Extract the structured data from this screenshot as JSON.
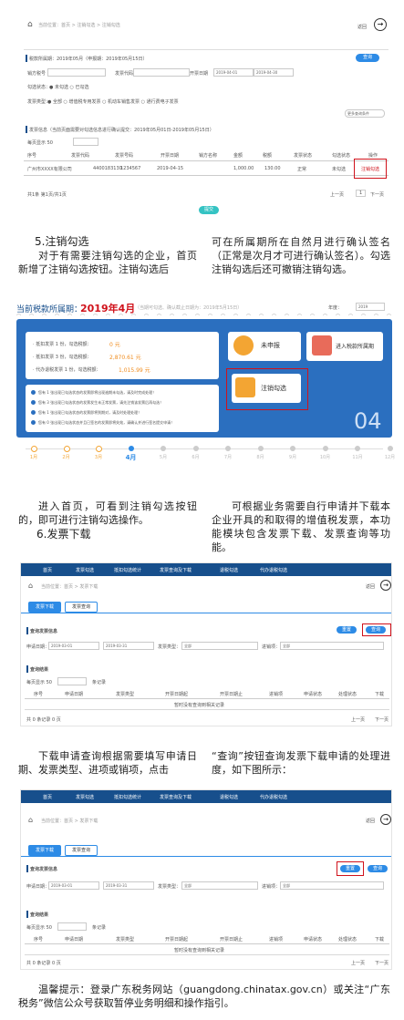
{
  "s1": {
    "home": "当前位置：首页 > 注销勾选 > 注销勾选",
    "return": "返回",
    "period_label": "税款所属期：2019年05月（申报期：2019年05月15日）",
    "query_btn": "查询",
    "f_buyer": "销方税号",
    "f_code": "发票代码",
    "f_date": "开票日期",
    "date_from": "2019-04-01",
    "date_to": "2019-04-30",
    "f_status": "勾选状态：",
    "status_opts": "● 未勾选  ○ 已勾选",
    "f_type": "发票类型：",
    "type_opts": "● 全部  ○ 增值税专用发票  ○ 机动车销售发票  ○ 通行费电子发票",
    "more_btn": "更多查询条件",
    "result_label": "发票信息（当前页面需要对勾选信息进行确认提交：2019年05月01日-2019年05月15日）",
    "per_page": "每页显示 50",
    "headers": [
      "序号",
      "发票代码",
      "发票号码",
      "开票日期",
      "销方名称",
      "金额",
      "税额",
      "发票状态",
      "勾选状态",
      "操作"
    ],
    "row": [
      "1",
      "广州市XXXX有限公司",
      "4400183130",
      "1234567",
      "2019-04-15",
      "1,000.00",
      "130.00",
      "正常",
      "未勾选",
      "注销勾选"
    ],
    "pager_info": "共1条  第1页/共1页",
    "prev": "上一页",
    "page_no": "1",
    "next": "下一页",
    "submit": "提交"
  },
  "p1": {
    "heading": "5.注销勾选",
    "left": "对于有需要注销勾选的企业，首页新增了注销勾选按钮。注销勾选后",
    "right": "可在所属期所在自然月进行确认签名（正常是次月才可进行确认签名）。勾选注销勾选后还可撤销注销勾选。"
  },
  "s2": {
    "title_pre": "当前税款所属期：",
    "title_period": "2019年4月",
    "title_note": "（当期可勾选、确认截止日期为：2019年5月15日）",
    "year_label": "年度：",
    "year_value": "2019",
    "stats": [
      {
        "label": "·  抵扣发票 1 份，勾选税额：",
        "value": "0 元"
      },
      {
        "label": "·  抵扣发票 3 份，勾选税额：",
        "value": "2,870.61 元"
      },
      {
        "label": "·  代办退税发票 1 份，勾选税额：",
        "value": "1,015.99 元"
      }
    ],
    "notices": [
      "您有 1 张出现已勾选状态的发票即将出现逾期未勾选，请及时完成处理！",
      "您有 3 张出现已勾选状态的发票发生未正常发票，请先注销该发票后再勾选！",
      "您有 1 张出现已勾选状态的发票即将到期对，请及时处理处理！",
      "您有 0 张出现已勾选状态并且已签名的发票即将失效，请确认并进行签名提交申请！"
    ],
    "card_weishen": "未申报",
    "card_jinru": "进入税款所属期",
    "card_zhuxiao": "注销勾选",
    "big_month": "04",
    "months": [
      "1月",
      "2月",
      "3月",
      "4月",
      "5月",
      "6月",
      "7月",
      "8月",
      "9月",
      "10月",
      "11月",
      "12月"
    ]
  },
  "p2": {
    "left": "进入首页，可看到注销勾选按钮的，即可进行注销勾选操作。",
    "heading": "6.发票下载",
    "right": "可根据业务需要自行申请并下载本企业开具的和取得的增值税发票，本功能模块包含发票下载、发票查询等功能。"
  },
  "s3": {
    "nav": [
      "首页",
      "发票勾选",
      "抵扣勾选统计",
      "发票查询及下载",
      "退税勾选",
      "代办退税勾选"
    ],
    "home": "当前位置：首页 > 发票下载",
    "return": "返回",
    "tab1": "发票下载",
    "tab2": "发票查询",
    "section": "查询发票信息",
    "reset": "重置",
    "query": "查询",
    "f_date": "申请日期：",
    "date_from": "2019-03-01",
    "date_to": "2019-03-31",
    "f_type": "发票类型：",
    "type_val": "全部",
    "f_dir": "进销项：",
    "dir_val": "全部",
    "result": "查询结果",
    "per_page": "每页显示 50",
    "per_unit": "条记录",
    "headers": [
      "序号",
      "申请日期",
      "发票类型",
      "开票日期起",
      "开票日期止",
      "进销项",
      "申请状态",
      "处理状态",
      "下载"
    ],
    "empty": "暂时没有查询到相关记录",
    "pager_info": "共 0 条记录 0 页",
    "prev": "上一页",
    "next": "下一页"
  },
  "p3": {
    "left": "下载申请查询根据需要填写申请日期、发票类型、进项或销项，点击",
    "right": "“查询”按钮查询发票下载申请的处理进度，如下图所示："
  },
  "s4": {
    "nav": [
      "首页",
      "发票勾选",
      "抵扣勾选统计",
      "发票查询及下载",
      "退税勾选",
      "代办退税勾选"
    ],
    "home": "当前位置：首页 > 发票下载",
    "return": "返回",
    "tab1": "发票下载",
    "tab2": "发票查询",
    "section": "查询发票信息",
    "reset": "重置",
    "query": "查询",
    "f_date": "申请日期：",
    "date_from": "2019-03-01",
    "date_to": "2019-03-31",
    "f_type": "发票类型：",
    "type_val": "全部",
    "f_dir": "进销项：",
    "dir_val": "全部",
    "result": "查询结果",
    "per_page": "每页显示 50",
    "per_unit": "条记录",
    "headers": [
      "序号",
      "申请日期",
      "发票类型",
      "开票日期起",
      "开票日期止",
      "进销项",
      "申请状态",
      "处理状态",
      "下载"
    ],
    "empty": "暂时没有查询到相关记录",
    "pager_info": "共 0 条记录 0 页",
    "prev": "上一页",
    "next": "下一页"
  },
  "footer": "温馨提示：登录广东税务网站（guangdong.chinatax.gov.cn）或关注“广东税务”微信公众号获取暂停业务明细和操作指引。"
}
